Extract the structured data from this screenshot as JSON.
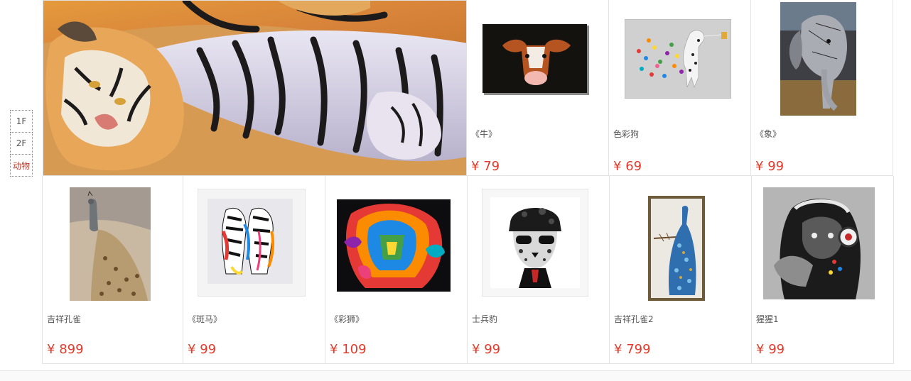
{
  "floor_nav": [
    {
      "label": "1F",
      "active": false
    },
    {
      "label": "2F",
      "active": false
    },
    {
      "label": "动物",
      "active": true
    }
  ],
  "currency_symbol": "¥",
  "products_top": [
    {
      "name": "《牛》",
      "price": "79"
    },
    {
      "name": "色彩狗",
      "price": "69"
    },
    {
      "name": "《象》",
      "price": "99"
    }
  ],
  "products_bottom": [
    {
      "name": "吉祥孔雀",
      "price": "899"
    },
    {
      "name": "《斑马》",
      "price": "99"
    },
    {
      "name": "《彩狮》",
      "price": "109"
    },
    {
      "name": "士兵豹",
      "price": "99"
    },
    {
      "name": "吉祥孔雀2",
      "price": "799"
    },
    {
      "name": "猩猩1",
      "price": "99"
    }
  ]
}
